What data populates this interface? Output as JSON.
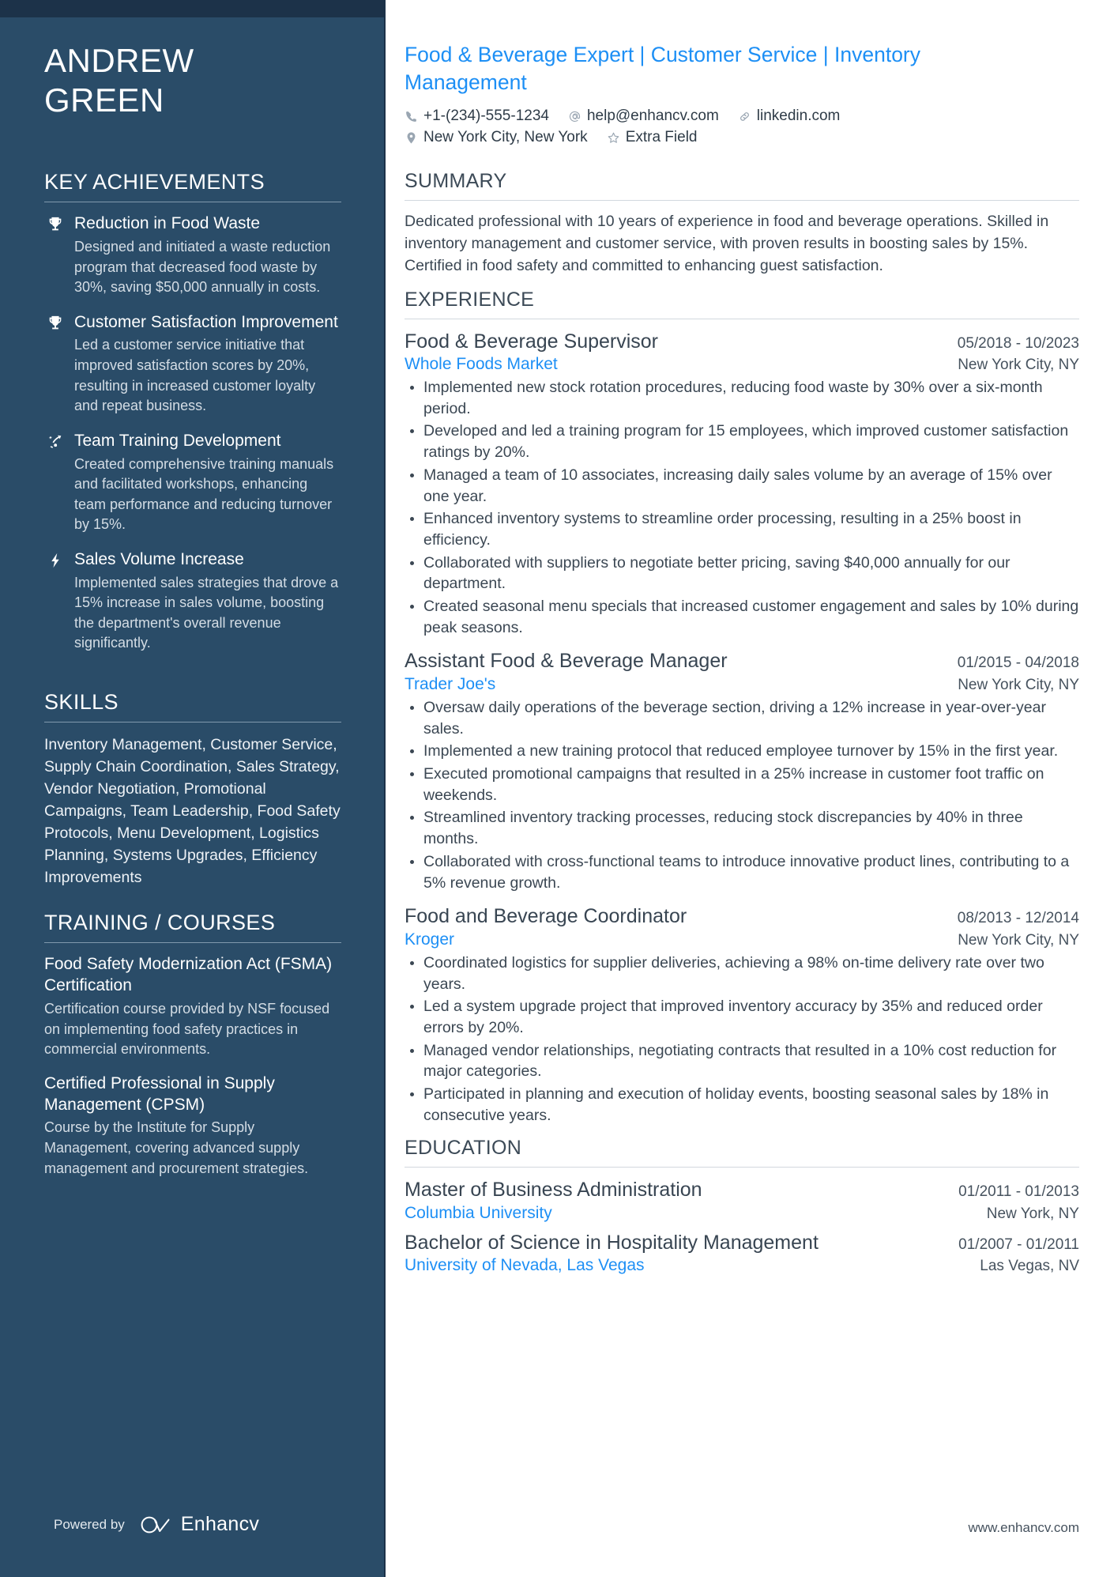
{
  "sidebar": {
    "name_lines": [
      "ANDREW",
      "GREEN"
    ],
    "sections": {
      "achievements_title": "KEY ACHIEVEMENTS",
      "skills_title": "SKILLS",
      "training_title": "TRAINING / COURSES"
    },
    "achievements": [
      {
        "icon": "trophy-icon",
        "title": "Reduction in Food Waste",
        "description": "Designed and initiated a waste reduction program that decreased food waste by 30%, saving $50,000 annually in costs."
      },
      {
        "icon": "trophy-icon",
        "title": "Customer Satisfaction Improvement",
        "description": "Led a customer service initiative that improved satisfaction scores by 20%, resulting in increased customer loyalty and repeat business."
      },
      {
        "icon": "growth-arrow-icon",
        "title": "Team Training Development",
        "description": "Created comprehensive training manuals and facilitated workshops, enhancing team performance and reducing turnover by 15%."
      },
      {
        "icon": "lightning-bolt-icon",
        "title": "Sales Volume Increase",
        "description": "Implemented sales strategies that drove a 15% increase in sales volume, boosting the department's overall revenue significantly."
      }
    ],
    "skills_text": "Inventory Management, Customer Service, Supply Chain Coordination, Sales Strategy, Vendor Negotiation, Promotional Campaigns, Team Leadership, Food Safety Protocols, Menu Development, Logistics Planning, Systems Upgrades, Efficiency Improvements",
    "courses": [
      {
        "title": "Food Safety Modernization Act (FSMA) Certification",
        "description": "Certification course provided by NSF focused on implementing food safety practices in commercial environments."
      },
      {
        "title": "Certified Professional in Supply Management (CPSM)",
        "description": "Course by the Institute for Supply Management, covering advanced supply management and procurement strategies."
      }
    ],
    "footer": {
      "powered_by": "Powered by",
      "brand": "Enhancv"
    }
  },
  "main": {
    "headline": "Food & Beverage Expert | Customer Service | Inventory Management",
    "contact": {
      "row1": [
        {
          "icon": "phone-icon",
          "text": "+1-(234)-555-1234"
        },
        {
          "icon": "email-icon",
          "text": "help@enhancv.com"
        },
        {
          "icon": "link-icon",
          "text": "linkedin.com"
        }
      ],
      "row2": [
        {
          "icon": "location-pin-icon",
          "text": "New York City, New York"
        },
        {
          "icon": "star-icon",
          "text": "Extra Field"
        }
      ]
    },
    "summary": {
      "title": "SUMMARY",
      "text": "Dedicated professional with 10 years of experience in food and beverage operations. Skilled in inventory management and customer service, with proven results in boosting sales by 15%. Certified in food safety and committed to enhancing guest satisfaction."
    },
    "experience": {
      "title": "EXPERIENCE",
      "entries": [
        {
          "role": "Food & Beverage Supervisor",
          "date": "05/2018 - 10/2023",
          "company": "Whole Foods Market",
          "location": "New York City, NY",
          "bullets": [
            "Implemented new stock rotation procedures, reducing food waste by 30% over a six-month period.",
            "Developed and led a training program for 15 employees, which improved customer satisfaction ratings by 20%.",
            "Managed a team of 10 associates, increasing daily sales volume by an average of 15% over one year.",
            "Enhanced inventory systems to streamline order processing, resulting in a 25% boost in efficiency.",
            "Collaborated with suppliers to negotiate better pricing, saving $40,000 annually for our department.",
            "Created seasonal menu specials that increased customer engagement and sales by 10% during peak seasons."
          ]
        },
        {
          "role": "Assistant Food & Beverage Manager",
          "date": "01/2015 - 04/2018",
          "company": "Trader Joe's",
          "location": "New York City, NY",
          "bullets": [
            "Oversaw daily operations of the beverage section, driving a 12% increase in year-over-year sales.",
            "Implemented a new training protocol that reduced employee turnover by 15% in the first year.",
            "Executed promotional campaigns that resulted in a 25% increase in customer foot traffic on weekends.",
            "Streamlined inventory tracking processes, reducing stock discrepancies by 40% in three months.",
            "Collaborated with cross-functional teams to introduce innovative product lines, contributing to a 5% revenue growth."
          ]
        },
        {
          "role": "Food and Beverage Coordinator",
          "date": "08/2013 - 12/2014",
          "company": "Kroger",
          "location": "New York City, NY",
          "bullets": [
            "Coordinated logistics for supplier deliveries, achieving a 98% on-time delivery rate over two years.",
            "Led a system upgrade project that improved inventory accuracy by 35% and reduced order errors by 20%.",
            "Managed vendor relationships, negotiating contracts that resulted in a 10% cost reduction for major categories.",
            "Participated in planning and execution of holiday events, boosting seasonal sales by 18% in consecutive years."
          ]
        }
      ]
    },
    "education": {
      "title": "EDUCATION",
      "entries": [
        {
          "degree": "Master of Business Administration",
          "date": "01/2011 - 01/2013",
          "school": "Columbia University",
          "location": "New York, NY"
        },
        {
          "degree": "Bachelor of Science in Hospitality Management",
          "date": "01/2007 - 01/2011",
          "school": "University of Nevada, Las Vegas",
          "location": "Las Vegas, NV"
        }
      ]
    },
    "footer_url": "www.enhancv.com"
  },
  "colors": {
    "sidebar_bg": "#2a4c68",
    "sidebar_topbar": "#1c3249",
    "accent_blue": "#1d8ff5",
    "body_text": "#3b4753"
  }
}
